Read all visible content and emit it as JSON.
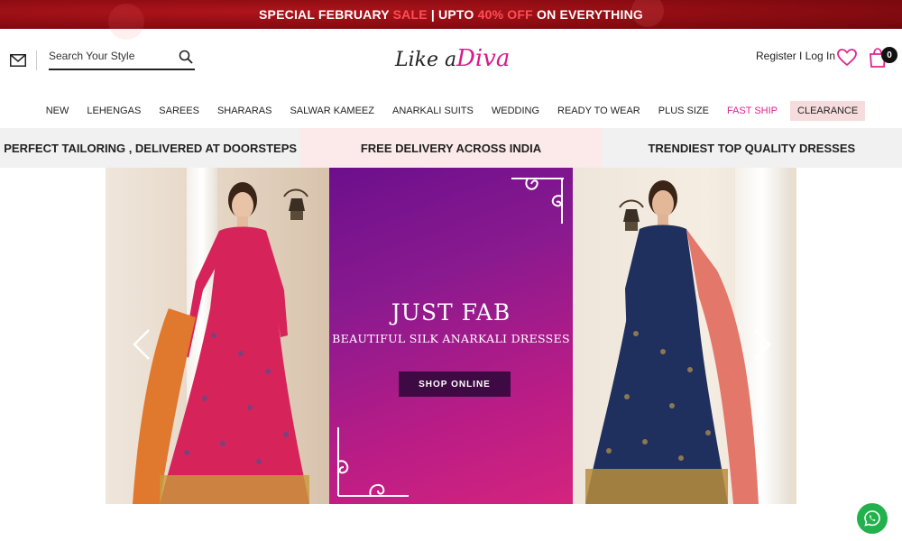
{
  "promo": {
    "part1": "SPECIAL FEBRUARY ",
    "sale": "SALE",
    "part2": " | UPTO ",
    "off": "40% OFF",
    "part3": " ON EVERYTHING"
  },
  "header": {
    "search_placeholder": "Search Your Style",
    "logo_like": "Like a",
    "logo_diva": "Diva",
    "auth_text": "Register I Log In",
    "cart_count": "0"
  },
  "nav": {
    "items": [
      "NEW",
      "LEHENGAS",
      "SAREES",
      "SHARARAS",
      "SALWAR KAMEEZ",
      "ANARKALI SUITS",
      "WEDDING",
      "READY TO WEAR",
      "PLUS SIZE",
      "FAST SHIP",
      "CLEARANCE"
    ]
  },
  "usp": {
    "left": "PERFECT TAILORING , DELIVERED AT DOORSTEPS",
    "middle": "FREE DELIVERY ACROSS INDIA",
    "right": "TRENDIEST TOP QUALITY DRESSES"
  },
  "banner": {
    "title": "JUST FAB",
    "subtitle": "BEAUTIFUL SILK ANARKALI DRESSES",
    "cta": "SHOP ONLINE"
  },
  "colors": {
    "promo_bg": "#8c0c12",
    "accent_pink": "#e0238f",
    "cta_bg": "#3d0a43",
    "whatsapp": "#22b14c"
  }
}
